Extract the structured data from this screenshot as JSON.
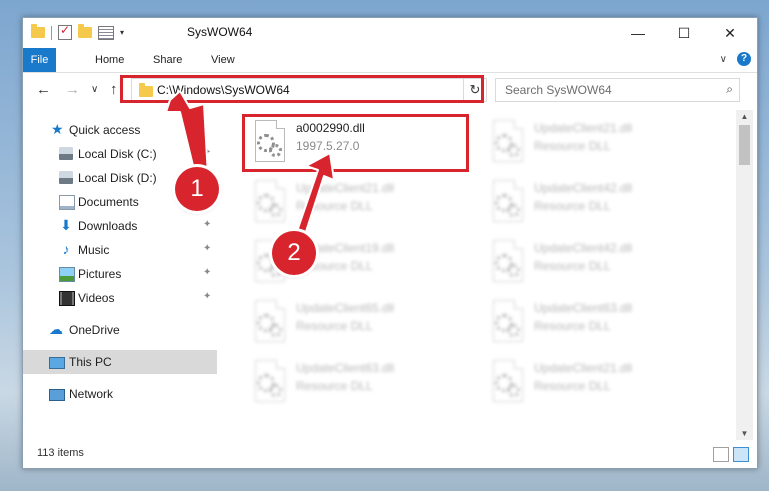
{
  "window": {
    "title": "SysWOW64"
  },
  "titlebar": {
    "minimize_glyph": "—",
    "maximize_glyph": "☐",
    "close_glyph": "✕",
    "qat_dropdown_glyph": "▾"
  },
  "ribbon": {
    "tabs": [
      "File",
      "Home",
      "Share",
      "View"
    ],
    "collapse_glyph": "∨",
    "help_glyph": "?"
  },
  "nav": {
    "back_glyph": "←",
    "forward_glyph": "→",
    "recent_glyph": "∨",
    "up_glyph": "↑",
    "address": "C:\\Windows\\SysWOW64",
    "address_dropdown_glyph": "∨",
    "refresh_glyph": "↻",
    "search_placeholder": "Search SysWOW64",
    "search_glyph": "⌕"
  },
  "sidebar": {
    "pin_glyph": "✦",
    "items": [
      {
        "label": "Quick access",
        "icon": "star-icon",
        "pinned": false
      },
      {
        "label": "Local Disk (C:)",
        "icon": "disk-icon",
        "pinned": true
      },
      {
        "label": "Local Disk (D:)",
        "icon": "disk-icon",
        "pinned": true
      },
      {
        "label": "Documents",
        "icon": "documents-icon",
        "pinned": true
      },
      {
        "label": "Downloads",
        "icon": "download-icon",
        "pinned": true
      },
      {
        "label": "Music",
        "icon": "music-icon",
        "pinned": true
      },
      {
        "label": "Pictures",
        "icon": "pictures-icon",
        "pinned": true
      },
      {
        "label": "Videos",
        "icon": "videos-icon",
        "pinned": true
      },
      {
        "label": "OneDrive",
        "icon": "cloud-icon",
        "pinned": false
      },
      {
        "label": "This PC",
        "icon": "computer-icon",
        "pinned": false,
        "selected": true
      },
      {
        "label": "Network",
        "icon": "network-icon",
        "pinned": false
      }
    ]
  },
  "files": [
    {
      "name": "a0002990.dll",
      "sub": "1997.5.27.0",
      "blurred": false
    },
    {
      "name": "UpdateClient21.dll",
      "sub": "Resource DLL",
      "blurred": true
    },
    {
      "name": "UpdateClient21.dll",
      "sub": "Resource DLL",
      "blurred": true
    },
    {
      "name": "UpdateClient42.dll",
      "sub": "Resource DLL",
      "blurred": true
    },
    {
      "name": "UpdateClient19.dll",
      "sub": "Resource DLL",
      "blurred": true
    },
    {
      "name": "UpdateClient42.dll",
      "sub": "Resource DLL",
      "blurred": true
    },
    {
      "name": "UpdateClient65.dll",
      "sub": "Resource DLL",
      "blurred": true
    },
    {
      "name": "UpdateClient63.dll",
      "sub": "Resource DLL",
      "blurred": true
    },
    {
      "name": "UpdateClient63.dll",
      "sub": "Resource DLL",
      "blurred": true
    },
    {
      "name": "UpdateClient21.dll",
      "sub": "Resource DLL",
      "blurred": true
    }
  ],
  "scroll": {
    "up_glyph": "▲",
    "down_glyph": "▼"
  },
  "status": {
    "item_count": "113 items"
  },
  "callouts": {
    "step1": "1",
    "step2": "2"
  },
  "colors": {
    "highlight": "#d8242c",
    "accent": "#1979ca"
  }
}
